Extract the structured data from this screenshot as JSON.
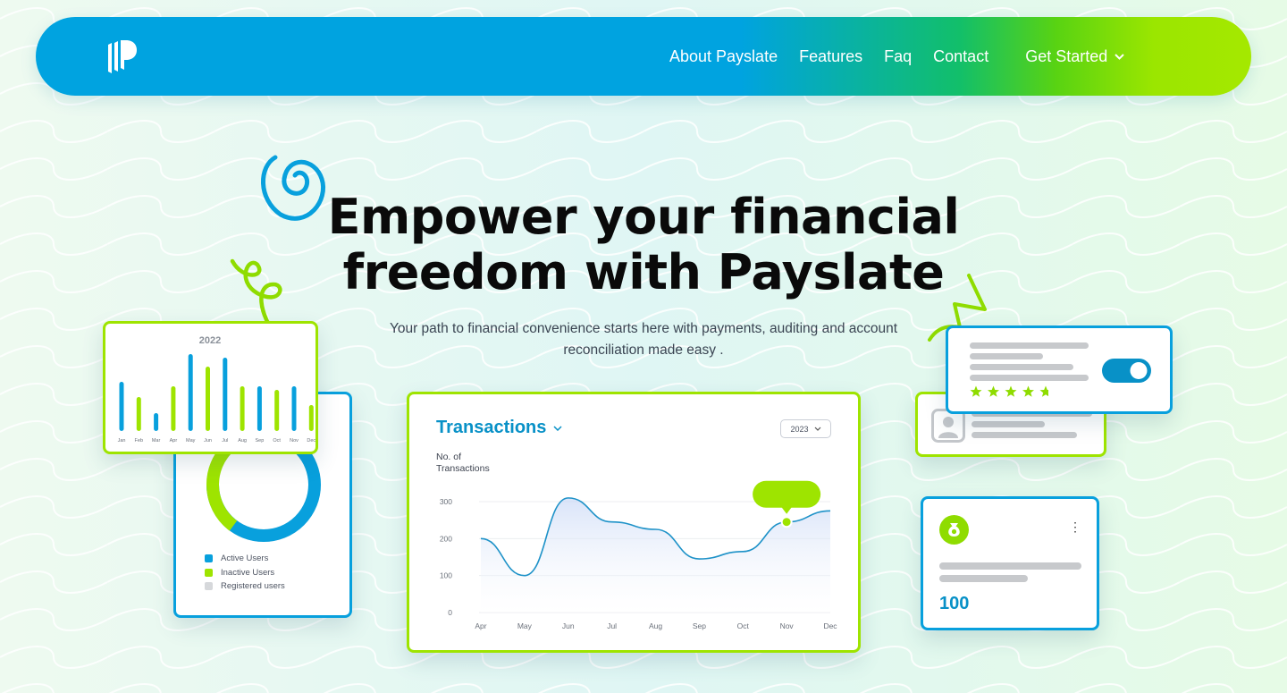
{
  "nav": {
    "links": [
      "About Payslate",
      "Features",
      "Faq",
      "Contact"
    ],
    "cta_label": "Get Started",
    "logo_icon": "payslate-logo-icon"
  },
  "hero": {
    "title_line1": "Empower your financial",
    "title_line2": "freedom with Payslate",
    "subtitle_line1": "Your path to financial convenience starts here with payments, auditing and account",
    "subtitle_line2": "reconciliation made easy ."
  },
  "colors": {
    "blue": "#08a0dd",
    "green": "#9ee400",
    "navy_text": "#0891c7",
    "gray": "#c7c9cc"
  },
  "bar_card": {
    "year": "2022"
  },
  "donut_card": {
    "legend": [
      {
        "label": "Active Users",
        "color": "#08a0dd"
      },
      {
        "label": "Inactive Users",
        "color": "#9ee400"
      },
      {
        "label": "Registered users",
        "color": "#d6d8db"
      }
    ]
  },
  "transactions_card": {
    "title": "Transactions",
    "year_selected": "2023",
    "y_title_line1": "No. of",
    "y_title_line2": "Transactions"
  },
  "toggle_card": {
    "toggle_on": true,
    "stars": 5
  },
  "stat_card": {
    "value": "100",
    "icon": "money-bag-icon",
    "menu_icon": "kebab-menu-icon"
  },
  "chart_data": [
    {
      "type": "bar",
      "title": "2022",
      "categories": [
        "Jan",
        "Feb",
        "Mar",
        "Apr",
        "May",
        "Jun",
        "Jul",
        "Aug",
        "Sep",
        "Oct",
        "Nov",
        "Dec"
      ],
      "values": [
        55,
        38,
        20,
        50,
        86,
        72,
        82,
        50,
        50,
        46,
        50,
        29
      ],
      "bar_colors": [
        "#08a0dd",
        "#9ee400",
        "#08a0dd",
        "#9ee400",
        "#08a0dd",
        "#9ee400",
        "#08a0dd",
        "#9ee400",
        "#08a0dd",
        "#9ee400",
        "#08a0dd",
        "#9ee400"
      ],
      "ylim": [
        0,
        100
      ]
    },
    {
      "type": "line",
      "title": "Transactions",
      "ylabel": "No. of Transactions",
      "categories": [
        "Apr",
        "May",
        "Jun",
        "Jul",
        "Aug",
        "Sep",
        "Oct",
        "Nov",
        "Dec"
      ],
      "values": [
        200,
        100,
        310,
        245,
        225,
        145,
        165,
        245,
        275
      ],
      "yticks": [
        0,
        100,
        200,
        300
      ],
      "ylim": [
        0,
        300
      ],
      "highlight_category": "Nov",
      "line_color": "#1e92c8"
    }
  ]
}
